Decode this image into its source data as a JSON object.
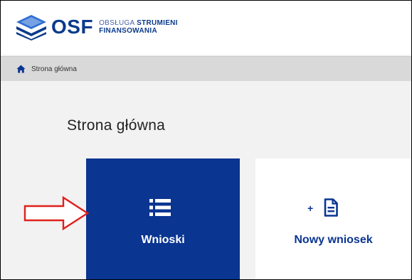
{
  "header": {
    "logo_text": "OSF",
    "subtitle_line1_thin": "OBSŁUGA",
    "subtitle_line1_bold": "STRUMIENI",
    "subtitle_line2": "FINANSOWANIA"
  },
  "breadcrumb": {
    "home_label": "Strona główna"
  },
  "main": {
    "page_title": "Strona główna",
    "tiles": [
      {
        "label": "Wnioski",
        "icon": "list-icon"
      },
      {
        "label": "Nowy wniosek",
        "icon": "new-document-icon",
        "prefix": "+"
      }
    ]
  },
  "annotation": {
    "icon": "red-arrow-icon",
    "color": "#e0201b"
  },
  "colors": {
    "brand": "#0a3591",
    "breadcrumb_bg": "#d9d9d9",
    "page_bg": "#f2f2f2"
  }
}
